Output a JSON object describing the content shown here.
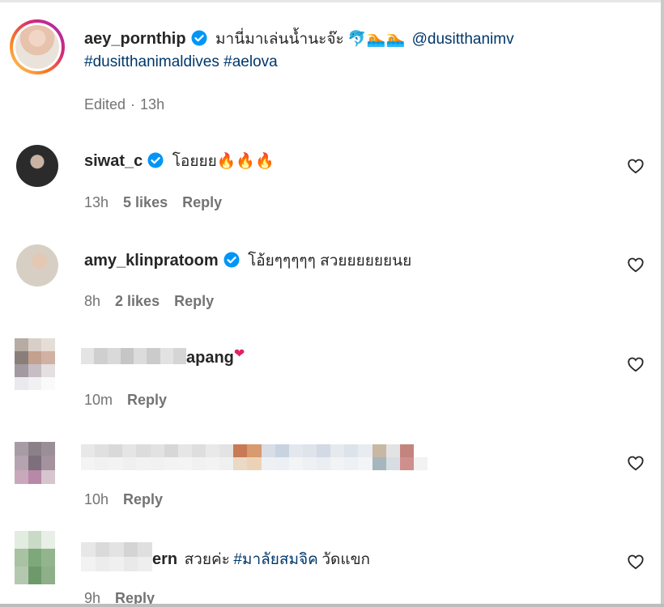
{
  "post": {
    "username": "aey_pornthip",
    "caption_text": "มานี่มาเล่นน้ำนะจ๊ะ",
    "caption_emoji": "🐬🏊🏊",
    "mention": "@dusitthanimv",
    "hashtags": "#dusitthanimaldives #aelova",
    "edited_label": "Edited",
    "time": "13h"
  },
  "comments": [
    {
      "username": "siwat_c",
      "text": "โอยยย🔥🔥🔥",
      "time": "13h",
      "likes": "5 likes",
      "reply": "Reply"
    },
    {
      "username": "amy_klinpratoom",
      "text": "โอ้ยๆๆๆๆๆ สวยยยยยยนย",
      "time": "8h",
      "likes": "2 likes",
      "reply": "Reply"
    },
    {
      "username_visible": "apang",
      "heart_emoji": "❤",
      "time": "10m",
      "reply": "Reply"
    },
    {
      "time": "10h",
      "reply": "Reply"
    },
    {
      "username_visible": "ern",
      "text": "สวยค่ะ",
      "hashtag": "#มาลัยสมจิค",
      "text_after": "วัดแขก",
      "time": "9h",
      "reply": "Reply"
    }
  ],
  "colors": {
    "verified_blue": "#0095f6",
    "link_blue": "#00376b",
    "meta_gray": "#737373",
    "story_ring": [
      "#feda75",
      "#fa7e1e",
      "#d62976",
      "#962fbf"
    ]
  },
  "icons": [
    "verified-badge-icon",
    "heart-icon",
    "fire-emoji",
    "dolphin-emoji",
    "swimmer-emoji"
  ]
}
